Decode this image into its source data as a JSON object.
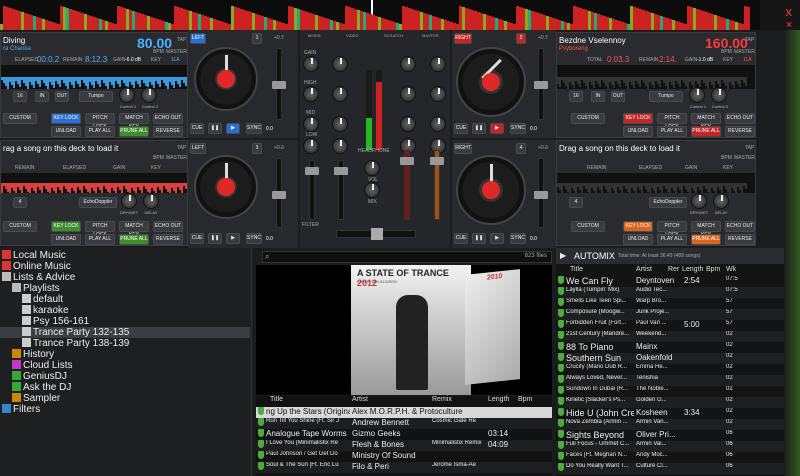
{
  "waveform_colors": {
    "bg": "#0c0c0c",
    "a": "#c22",
    "b": "#8a2",
    "c": "#2a7"
  },
  "top_right": {
    "close_icon": "close-icon",
    "label": "X"
  },
  "deck1": {
    "title": "Diving",
    "artist": "ra Chanka",
    "bpm": "80.00",
    "bpm_label": "BPM",
    "master": "MASTER",
    "tap": "TAP",
    "elapsed_label": "ELAPSED",
    "elapsed": "00:0.2",
    "remain_label": "REMAIN",
    "remain": "8:12.3",
    "gain_label": "GAIN",
    "gain": "-6.0 dB",
    "key_label": "KEY",
    "key": "11A",
    "loop": "16",
    "in": "IN",
    "out": "OUT",
    "fx": "Tumpo",
    "c1": "Control 1",
    "c2": "Control 2",
    "custom": "CUSTOM",
    "keylock": "KEY LOCK",
    "pitchlock": "PITCH LOCK",
    "matchkey": "MATCH KEY",
    "echoout": "ECHO OUT",
    "unload": "UNLOAD",
    "playall": "PLAY ALL",
    "prunell": "PRUNE ALL",
    "reverse": "REVERSE",
    "left_btn": "LEFT",
    "cue": "CUE",
    "sync": "SYNC",
    "pitch": "+0.7",
    "deck_no": "1",
    "pitch_value": "0.0"
  },
  "deck2": {
    "title": "Bezdne Vselennoy",
    "artist": "Psyborerig",
    "bpm": "160.00",
    "bpm_label": "BPM",
    "master": "MASTER",
    "tap": "TAP",
    "elapsed_label": "TOTAL",
    "elapsed": "0:03.3",
    "remain_label": "REMAIN",
    "remain": "2:14.",
    "gain_label": "GAIN",
    "gain": "-1.0 dB",
    "key_label": "KEY",
    "key": "11A",
    "loop": "16",
    "in": "IN",
    "out": "OUT",
    "fx": "Tumpo",
    "c1": "Control 1",
    "c2": "Control 2",
    "custom": "CUSTOM",
    "keylock": "KEY LOCK",
    "pitchlock": "PITCH LOCK",
    "matchkey": "MATCH KEY",
    "echoout": "ECHO OUT",
    "unload": "UNLOAD",
    "playall": "PLAY ALL",
    "prunell": "PRUNE ALL",
    "reverse": "REVERSE",
    "right_btn": "RIGHT",
    "cue": "CUE",
    "sync": "SYNC",
    "pitch": "+0.7",
    "deck_no": "2",
    "pitch_value": "0.0"
  },
  "deck3": {
    "prompt": "rag a song on this deck to load it",
    "bpm_label": "BPM",
    "master": "MASTER",
    "tap": "TAP",
    "remain_label": "REMAIN",
    "elapsed_label": "ELAPSED",
    "gain_label": "GAIN",
    "key_label": "KEY",
    "fx": "EchoDoppler",
    "drywet": "DRY/WET",
    "delay": "DELAY",
    "custom": "CUSTOM",
    "keylock": "KEY LOCK",
    "pitchlock": "PITCH LOCK",
    "matchkey": "MATCH KEY",
    "echoout": "ECHO OUT",
    "unload": "UNLOAD",
    "playall": "PLAY ALL",
    "prunell": "PRUNE ALL",
    "reverse": "REVERSE",
    "left_btn": "LEFT",
    "cue": "CUE",
    "sync": "SYNC",
    "pitch": "+0.0",
    "deck_no": "3",
    "loop": "4",
    "pitch_value": "0.0"
  },
  "deck4": {
    "prompt": "Drag a song on this deck to load it",
    "bpm_label": "BPM",
    "master": "MASTER",
    "tap": "TAP",
    "remain_label": "REMAIN",
    "elapsed_label": "ELAPSED",
    "gain_label": "GAIN",
    "key_label": "KEY",
    "fx": "EchoDoppler",
    "drywet": "DRY/WET",
    "delay": "DELAY",
    "custom": "CUSTOM",
    "keylock": "KEY LOCK",
    "pitchlock": "PITCH LOCK",
    "matchkey": "MATCH KEY",
    "echoout": "ECHO OUT",
    "unload": "UNLOAD",
    "playall": "PLAY ALL",
    "prunell": "PRUNE ALL",
    "reverse": "REVERSE",
    "right_btn": "RIGHT",
    "cue": "CUE",
    "sync": "SYNC",
    "pitch": "+0.0",
    "deck_no": "4",
    "loop": "4",
    "pitch_value": "0.0"
  },
  "mixer": {
    "tabs": [
      "MIXER",
      "VIDEO",
      "SCRATCH",
      "MASTER"
    ],
    "gain": "GAIN",
    "high": "HIGH",
    "mid": "MID",
    "low": "LOW",
    "filter": "FILTER",
    "headphone": "HEADPHONE",
    "vol": "VOL",
    "mix": "MIX"
  },
  "browser": {
    "items": [
      {
        "label": "Local Music",
        "icon": "local-music-icon"
      },
      {
        "label": "Online Music",
        "icon": "online-music-icon"
      },
      {
        "label": "Lists & Advice",
        "icon": "lists-icon"
      },
      {
        "label": "Playlists",
        "icon": "playlists-icon"
      },
      {
        "label": "default",
        "icon": "playlist-icon"
      },
      {
        "label": "karaoke",
        "icon": "playlist-icon"
      },
      {
        "label": "Psy 156-161",
        "icon": "playlist-icon"
      },
      {
        "label": "Trance Party 132-135",
        "icon": "playlist-icon"
      },
      {
        "label": "Trance Party 138-139",
        "icon": "playlist-icon"
      },
      {
        "label": "History",
        "icon": "history-icon"
      },
      {
        "label": "Cloud Lists",
        "icon": "cloud-icon"
      },
      {
        "label": "GeniusDJ",
        "icon": "genius-icon"
      },
      {
        "label": "Ask the DJ",
        "icon": "ask-icon"
      },
      {
        "label": "Sampler",
        "icon": "sampler-icon"
      },
      {
        "label": "Filters",
        "icon": "filters-icon"
      }
    ]
  },
  "search": {
    "placeholder": "",
    "count": "823 files"
  },
  "cover": {
    "title": "A STATE OF TRANCE",
    "year": "2012",
    "subtitle": "ARMIN VAN BUUREN",
    "back_year": "2010"
  },
  "tracklist": {
    "headers": [
      "Title",
      "Artist",
      "Remix",
      "Length",
      "Bpm"
    ],
    "rows": [
      {
        "title": "ng Up the Stars (Original Mix",
        "artist": "Alex M.O.R.P.H. & Protoculture",
        "remix": "",
        "length": "",
        "bpm": ""
      },
      {
        "title": "Run Till You Shine (Ft. Sir J",
        "artist": "Andrew Bennett",
        "remix": "Cosmic Gate Re",
        "length": "",
        "bpm": ""
      },
      {
        "title": "Analogue Tape Worms",
        "artist": "Gizmo Geeks",
        "remix": "",
        "length": "03:14",
        "bpm": ""
      },
      {
        "title": "I Love You (Minimalistix Re",
        "artist": "Flesh & Bones",
        "remix": "Minimalistix Remix",
        "length": "04:09",
        "bpm": ""
      },
      {
        "title": "Paul Johnson / Get Get Do",
        "artist": "Ministry Of Sound",
        "remix": "",
        "length": "",
        "bpm": ""
      },
      {
        "title": "Soul & The Sun [Ft. Eric Lu",
        "artist": "Filo & Peri",
        "remix": "Jerome Isma-Ae",
        "length": "",
        "bpm": ""
      }
    ]
  },
  "automix": {
    "label": "AUTOMIX",
    "info": "Total time: At least 36:49 (489 songs)",
    "headers": [
      "Title",
      "Artist",
      "Rer",
      "Length",
      "Bpm",
      "Wk"
    ],
    "rows": [
      {
        "title": "We Can Fly",
        "artist": "Deyntoven",
        "length": "2:54",
        "wk": "07:5"
      },
      {
        "title": "Laylla (Tumpin' Mix)",
        "artist": "Audio Tec...",
        "length": "",
        "wk": "07:5"
      },
      {
        "title": "Smells Like Teen Spi...",
        "artist": "Warp Bro...",
        "length": "",
        "wk": "57"
      },
      {
        "title": "Composure (Moogw...",
        "artist": "Junk Proje...",
        "length": "",
        "wk": "57"
      },
      {
        "title": "Forbidden Fruit (Fort...",
        "artist": "Paul Van ...",
        "length": "5:00",
        "wk": "57"
      },
      {
        "title": "21st Century (Mandre...",
        "artist": "Weekend...",
        "length": "",
        "wk": "02"
      },
      {
        "title": "88 To Piano",
        "artist": "Mainx",
        "length": "",
        "wk": "02"
      },
      {
        "title": "Southern Sun",
        "artist": "Oakenfold",
        "length": "",
        "wk": "02"
      },
      {
        "title": "Crucify (Mario Dub R...",
        "artist": "Emma He...",
        "length": "",
        "wk": "02"
      },
      {
        "title": "Always Loved, Never...",
        "artist": "Tenishia",
        "length": "",
        "wk": "02"
      },
      {
        "title": "Sundown In Dubai (R...",
        "artist": "The Noble...",
        "length": "",
        "wk": "02"
      },
      {
        "title": "Kinetic [Slacker's Ps...",
        "artist": "Golden G...",
        "length": "",
        "wk": "02"
      },
      {
        "title": "Hide U (John Cream...",
        "artist": "Kosheen",
        "length": "3:34",
        "wk": "02"
      },
      {
        "title": "Nova Zembla (Armin ...",
        "artist": "Armin Van...",
        "length": "",
        "wk": "02"
      },
      {
        "title": "Sights Beyond",
        "artist": "Oliver Pri...",
        "length": "",
        "wk": "06"
      },
      {
        "title": "Full Focus - Ummet C...",
        "artist": "Armin Vai...",
        "length": "",
        "wk": "06"
      },
      {
        "title": "Faces [Ft. Meghan N...",
        "artist": "Andy Moc...",
        "length": "",
        "wk": "06"
      },
      {
        "title": "Do You Really Want T...",
        "artist": "Culture Cl...",
        "length": "",
        "wk": "06"
      }
    ]
  }
}
